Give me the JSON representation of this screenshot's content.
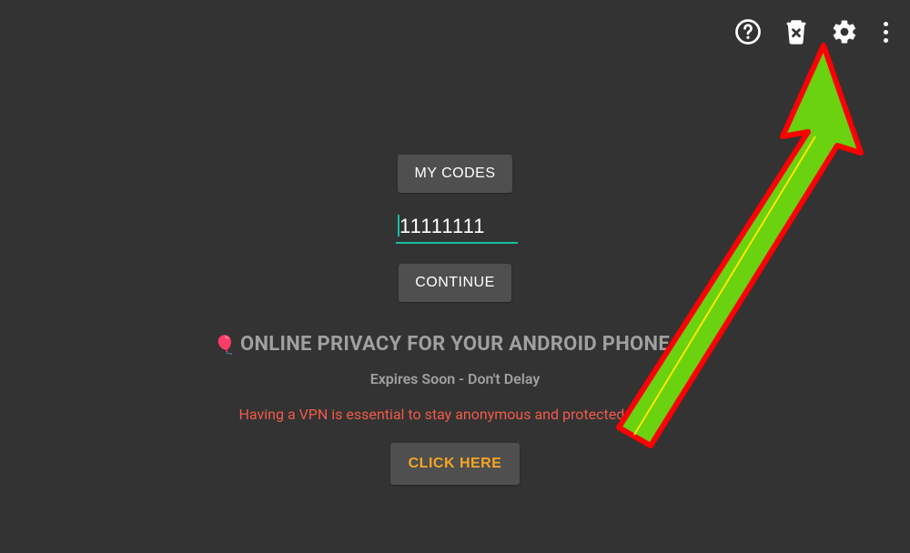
{
  "toolbar": {
    "help": "help-icon",
    "delete": "delete-icon",
    "settings": "gear-icon",
    "more": "more-icon"
  },
  "buttons": {
    "my_codes": "MY CODES",
    "continue": "CONTINUE",
    "click_here": "CLICK HERE"
  },
  "input": {
    "code_value": "11111111"
  },
  "promo": {
    "balloon": "🎈",
    "headline": "ONLINE PRIVACY FOR YOUR ANDROID PHONE",
    "subhead": "Expires Soon - Don't Delay",
    "warning": "Having a VPN is essential to stay anonymous and protected online."
  },
  "annotation": {
    "arrow_target": "settings-button",
    "arrow_color_fill": "#6ad20f",
    "arrow_color_stroke": "#ff0000"
  }
}
